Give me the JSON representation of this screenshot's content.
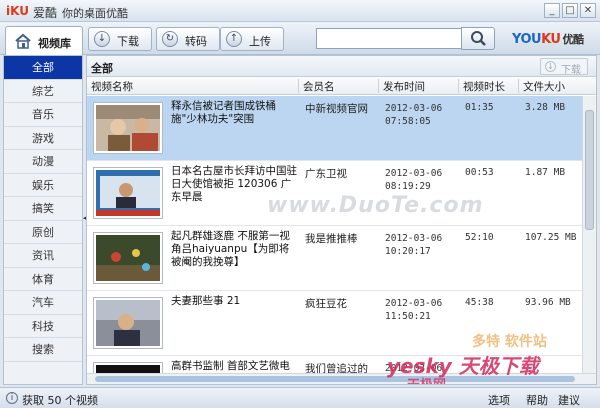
{
  "app": {
    "logo": "iKU",
    "logo_cn": "爱酷",
    "title": "你的桌面优酷"
  },
  "window": {
    "min": "_",
    "max": "□",
    "close": "✕"
  },
  "toolbar": {
    "library_tab": "视频库",
    "buttons": [
      {
        "label": "下载",
        "icon": "download-icon"
      },
      {
        "label": "转码",
        "icon": "transcode-icon"
      },
      {
        "label": "上传",
        "icon": "upload-icon"
      }
    ],
    "search_value": "",
    "brand_you": "YOU",
    "brand_ku": "KU",
    "brand_cn": "优酷"
  },
  "sidebar": {
    "items": [
      {
        "label": "全部"
      },
      {
        "label": "综艺"
      },
      {
        "label": "音乐"
      },
      {
        "label": "游戏"
      },
      {
        "label": "动漫"
      },
      {
        "label": "娱乐"
      },
      {
        "label": "搞笑"
      },
      {
        "label": "原创"
      },
      {
        "label": "资讯"
      },
      {
        "label": "体育"
      },
      {
        "label": "汽车"
      },
      {
        "label": "科技"
      },
      {
        "label": "搜索"
      }
    ],
    "active_index": 0
  },
  "main": {
    "crumb": "全部",
    "download_label": "下载",
    "columns": [
      "视频名称",
      "会员名",
      "发布时间",
      "视频时长",
      "文件大小"
    ],
    "rows": [
      {
        "name": "释永信被记者围成铁桶 施\"少林功夫\"突围",
        "member": "中新视频官网",
        "date1": "2012-03-06",
        "date2": "07:58:05",
        "duration": "01:35",
        "size": "3.28 MB"
      },
      {
        "name": "日本名古屋市长拜访中国驻日大使馆被拒 120306 广东早晨",
        "member": "广东卫视",
        "date1": "2012-03-06",
        "date2": "08:19:29",
        "duration": "00:53",
        "size": "1.87 MB"
      },
      {
        "name": "起凡群雄逐鹿 不服第一视角吕haiyuanpu【为即将被阉的我挽尊】",
        "member": "我是推推棒",
        "date1": "2012-03-06",
        "date2": "10:20:17",
        "duration": "52:10",
        "size": "107.25 MB"
      },
      {
        "name": "夫妻那些事 21",
        "member": "疯狂豆花",
        "date1": "2012-03-06",
        "date2": "11:50:21",
        "duration": "45:38",
        "size": "93.96 MB"
      },
      {
        "name": "高群书监制 首部文艺微电",
        "member": "我们曾追过的",
        "date1": "2012-03-06",
        "date2": "",
        "duration": "",
        "size": ""
      }
    ]
  },
  "status": {
    "text": "获取 50 个视频",
    "options": "选项",
    "help": "帮助",
    "suggest": "建议"
  },
  "watermarks": {
    "center": "www.DuoTe.com",
    "br1": "多特 软件站",
    "br2": "yesky 天极下载",
    "br3": "天极网"
  }
}
